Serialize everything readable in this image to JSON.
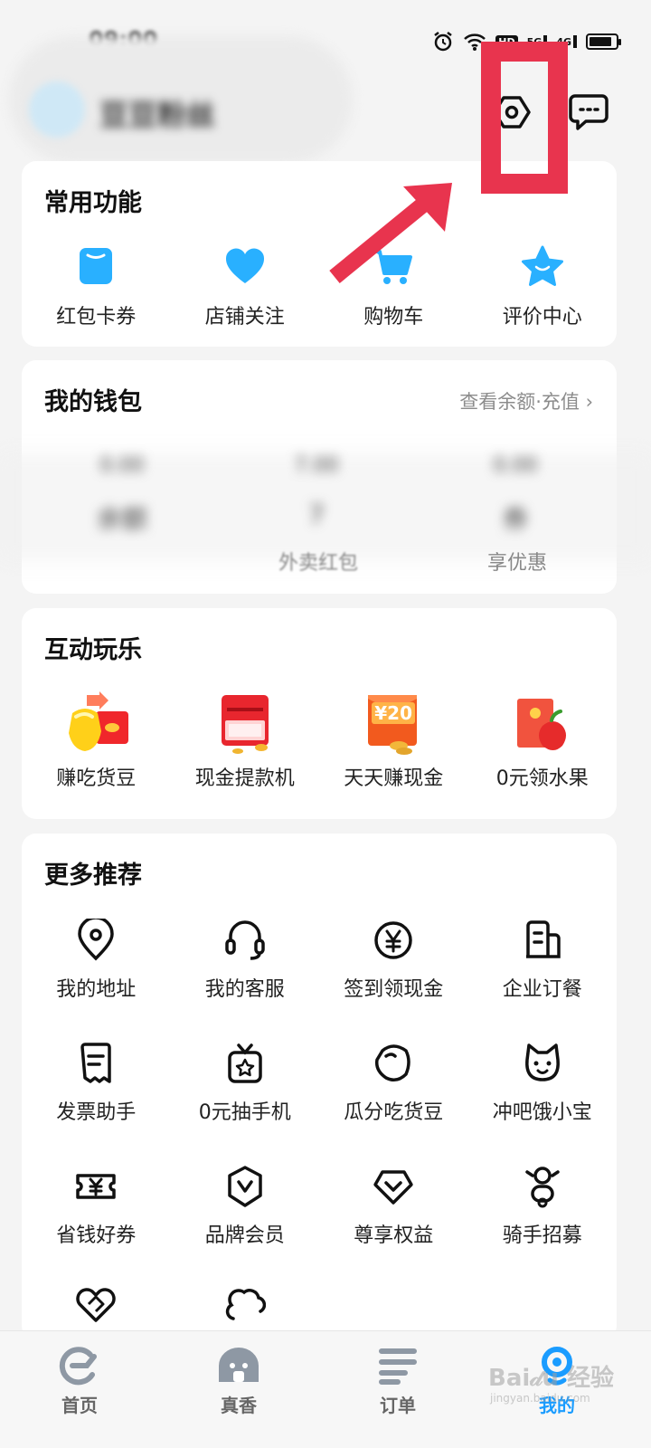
{
  "status_bar": {
    "time": "09:00",
    "hd": "HD",
    "net1": "5G",
    "net2": "4G"
  },
  "header": {
    "username": "豆豆粉丝"
  },
  "common_functions": {
    "title": "常用功能",
    "items": [
      {
        "label": "红包卡券",
        "icon": "coupon-card-icon"
      },
      {
        "label": "店铺关注",
        "icon": "heart-icon"
      },
      {
        "label": "购物车",
        "icon": "cart-icon"
      },
      {
        "label": "评价中心",
        "icon": "star-icon"
      }
    ]
  },
  "wallet": {
    "title": "我的钱包",
    "link": "查看余额·充值",
    "columns": [
      {
        "top": "0.00",
        "value": "余额",
        "label": ""
      },
      {
        "top": "7.00",
        "value": "7",
        "label": "外卖红包"
      },
      {
        "top": "0.00",
        "value": "券",
        "label": "享优惠"
      }
    ]
  },
  "interactive": {
    "title": "互动玩乐",
    "items": [
      {
        "label": "赚吃货豆",
        "icon": "beans-icon"
      },
      {
        "label": "现金提款机",
        "icon": "atm-icon"
      },
      {
        "label": "天天赚现金",
        "icon": "red-envelope-20-icon",
        "badge": "¥20"
      },
      {
        "label": "0元领水果",
        "icon": "apple-icon"
      }
    ]
  },
  "more": {
    "title": "更多推荐",
    "items": [
      {
        "label": "我的地址",
        "icon": "location-pin-icon"
      },
      {
        "label": "我的客服",
        "icon": "headset-icon"
      },
      {
        "label": "签到领现金",
        "icon": "yen-circle-icon"
      },
      {
        "label": "企业订餐",
        "icon": "building-icon"
      },
      {
        "label": "发票助手",
        "icon": "receipt-icon"
      },
      {
        "label": "0元抽手机",
        "icon": "gift-phone-icon"
      },
      {
        "label": "瓜分吃货豆",
        "icon": "bean-icon"
      },
      {
        "label": "冲吧饿小宝",
        "icon": "cat-icon"
      },
      {
        "label": "省钱好券",
        "icon": "yen-ticket-icon"
      },
      {
        "label": "品牌会员",
        "icon": "brand-badge-icon"
      },
      {
        "label": "尊享权益",
        "icon": "diamond-icon"
      },
      {
        "label": "骑手招募",
        "icon": "rider-icon"
      }
    ],
    "partial_items": [
      {
        "icon": "handshake-icon"
      },
      {
        "icon": "cloud-icon"
      }
    ]
  },
  "tabbar": {
    "items": [
      {
        "label": "首页",
        "icon": "home-e-icon"
      },
      {
        "label": "真香",
        "icon": "ghost-icon"
      },
      {
        "label": "订单",
        "icon": "list-icon"
      },
      {
        "label": "我的",
        "icon": "profile-icon",
        "active": true
      }
    ]
  },
  "watermark": {
    "text": "Bai𝒹u 经验",
    "sub": "jingyan.baidu.com"
  },
  "colors": {
    "accent": "#1a9cff",
    "annotation": "#e8344e",
    "card": "#ffffff",
    "background": "#f4f4f4"
  }
}
